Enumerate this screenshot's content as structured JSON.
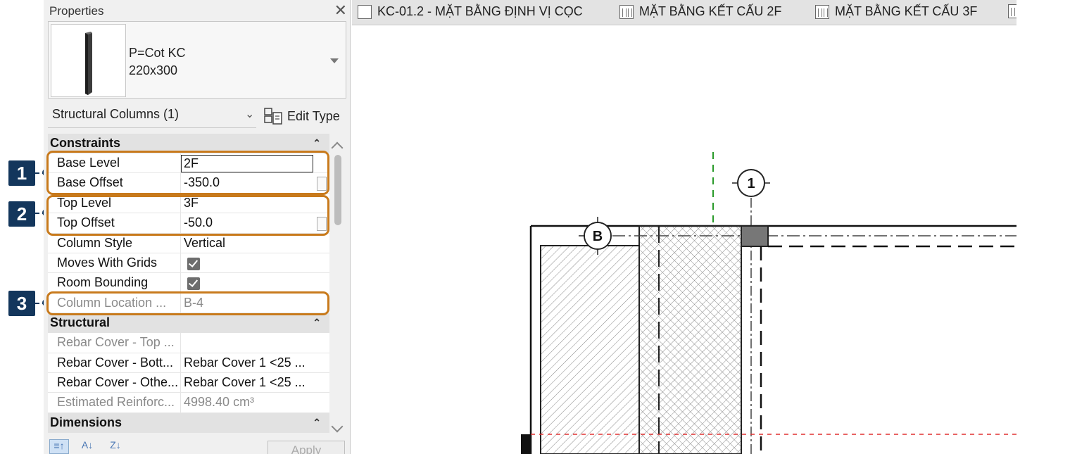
{
  "panel": {
    "title": "Properties",
    "close_label": "✕",
    "type_name_line1": "P=Cot KC",
    "type_name_line2": "220x300",
    "filter_label": "Structural Columns (1)",
    "edit_type_label": "Edit Type"
  },
  "sections": {
    "constraints": "Constraints",
    "structural": "Structural",
    "dimensions": "Dimensions"
  },
  "constraints_rows": [
    {
      "label": "Base Level",
      "value": "2F"
    },
    {
      "label": "Base Offset",
      "value": "-350.0"
    },
    {
      "label": "Top Level",
      "value": "3F"
    },
    {
      "label": "Top Offset",
      "value": "-50.0"
    },
    {
      "label": "Column Style",
      "value": "Vertical"
    },
    {
      "label": "Moves With Grids",
      "value": "checked"
    },
    {
      "label": "Room Bounding",
      "value": "checked"
    },
    {
      "label": "Column Location ...",
      "value": "B-4"
    }
  ],
  "structural_rows": [
    {
      "label": "Rebar Cover - Top ...",
      "value": ""
    },
    {
      "label": "Rebar Cover - Bott...",
      "value": "Rebar Cover 1 <25 ..."
    },
    {
      "label": "Rebar Cover - Othe...",
      "value": "Rebar Cover 1 <25 ..."
    },
    {
      "label": "Estimated Reinforc...",
      "value": "4998.40 cm³"
    }
  ],
  "bottom": {
    "apply_label": "Apply"
  },
  "callouts": [
    "1",
    "2",
    "3"
  ],
  "tabs": [
    {
      "label": "KC-01.2 - MẶT BẰNG ĐỊNH VỊ CỌC",
      "icon": "plan-view-icon"
    },
    {
      "label": "MẶT BẰNG KẾT CẤU 2F",
      "icon": "sheet-view-icon"
    },
    {
      "label": "MẶT BẰNG KẾT CẤU 3F",
      "icon": "sheet-view-icon"
    }
  ],
  "drawing": {
    "grid_bubble_1": "1",
    "grid_bubble_b": "B"
  },
  "colors": {
    "callout": "#13365c",
    "highlight": "#c87a1c",
    "hidden_line_green": "#2a9a2a",
    "hidden_line_red": "#e03030"
  }
}
